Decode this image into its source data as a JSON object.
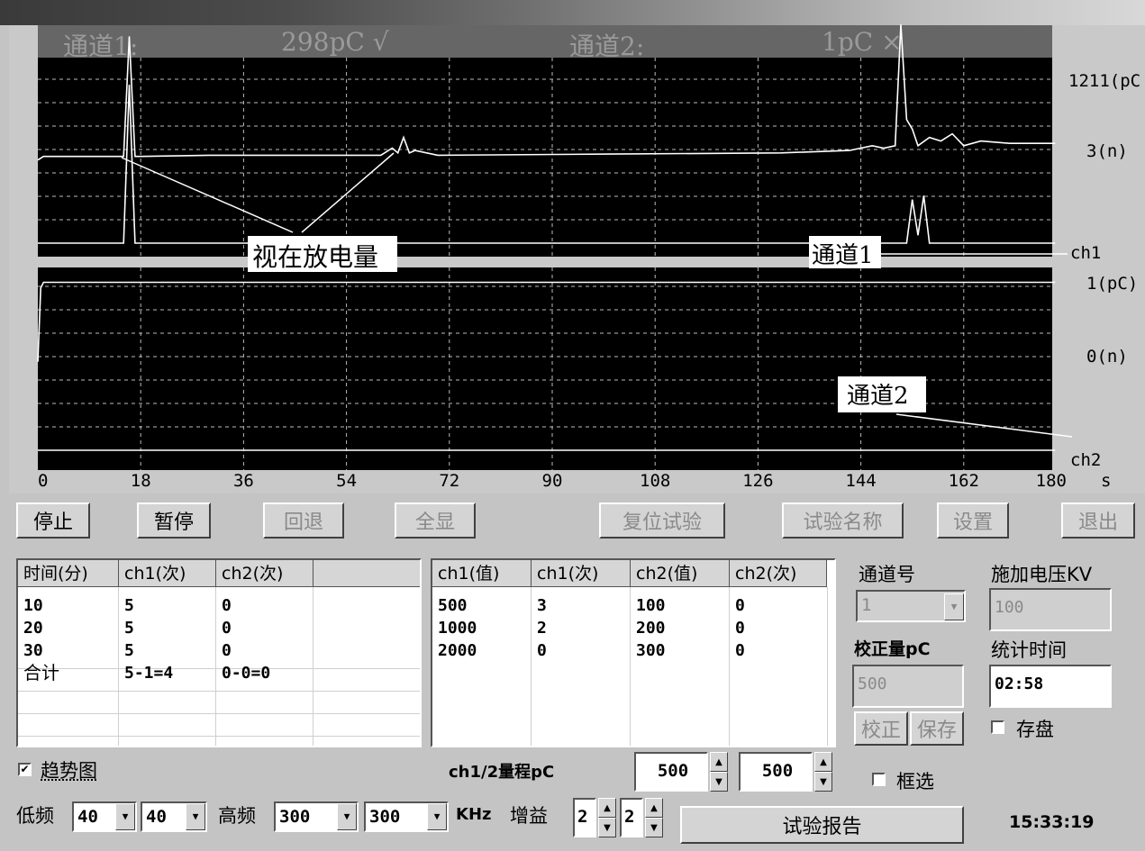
{
  "status": {
    "ch1_label": "通道1:",
    "ch1_value": "298pC √",
    "ch2_label": "通道2:",
    "ch2_value": "1pC ×"
  },
  "chart_data": {
    "type": "line",
    "x_ticks": [
      "0",
      "18",
      "36",
      "54",
      "72",
      "90",
      "108",
      "126",
      "144",
      "162",
      "180"
    ],
    "x_unit": "s",
    "xlim": [
      0,
      180
    ],
    "right_labels": {
      "ch1_top": "1211(pC",
      "ch1_mid": "3(n)",
      "ch1_name": "ch1",
      "ch2_top": "1(pC)",
      "ch2_mid": "0(n)",
      "ch2_name": "ch2"
    },
    "annotations": {
      "apparent_discharge": "视在放电量",
      "channel1": "通道1",
      "channel2": "通道2"
    },
    "series": [
      {
        "name": "ch1",
        "x": [
          0,
          1,
          15,
          16,
          17,
          18,
          30,
          40,
          60,
          62,
          63,
          64,
          65,
          66,
          70,
          100,
          130,
          142,
          146,
          148,
          150,
          151,
          152,
          153,
          154,
          156,
          158,
          160,
          162,
          165,
          170,
          178
        ],
        "y": [
          2.6,
          2.9,
          2.9,
          13.0,
          2.9,
          2.9,
          3.0,
          3.0,
          3.0,
          3.6,
          3.2,
          4.5,
          3.2,
          3.4,
          3.0,
          3.1,
          3.2,
          3.4,
          3.8,
          3.6,
          3.8,
          14.0,
          6.0,
          5.2,
          3.8,
          4.5,
          4.2,
          4.8,
          3.8,
          4.2,
          4.0,
          4.0
        ]
      },
      {
        "name": "ch1_pulse",
        "x": [
          0,
          14,
          15,
          16,
          17,
          18,
          150,
          152,
          153,
          154,
          155,
          156,
          178
        ],
        "y": [
          0,
          0,
          0,
          8.0,
          0,
          0,
          0,
          0,
          2.2,
          0.4,
          2.4,
          0,
          0
        ]
      },
      {
        "name": "ch2",
        "x": [
          0,
          0.5,
          1,
          178
        ],
        "y": [
          0.2,
          2.8,
          3.0,
          3.0
        ]
      },
      {
        "name": "ch2_base",
        "x": [
          0,
          178
        ],
        "y": [
          0,
          0
        ]
      }
    ]
  },
  "buttons": {
    "stop": "停止",
    "pause": "暂停",
    "back": "回退",
    "show_all": "全显",
    "reset_test": "复位试验",
    "test_name": "试验名称",
    "settings": "设置",
    "exit": "退出"
  },
  "table1": {
    "headers": [
      "时间(分)",
      "ch1(次)",
      "ch2(次)",
      ""
    ],
    "rows": [
      [
        "10",
        "5",
        "0"
      ],
      [
        "20",
        "5",
        "0"
      ],
      [
        "30",
        "5",
        "0"
      ],
      [
        "合计",
        "5-1=4",
        "0-0=0"
      ]
    ]
  },
  "table2": {
    "headers": [
      "ch1(值)",
      "ch1(次)",
      "ch2(值)",
      "ch2(次)"
    ],
    "rows": [
      [
        "500",
        "3",
        "100",
        "0"
      ],
      [
        "1000",
        "2",
        "200",
        "0"
      ],
      [
        "2000",
        "0",
        "300",
        "0"
      ]
    ]
  },
  "right_panel": {
    "channel_label": "通道号",
    "channel_value": "1",
    "voltage_label": "施加电压KV",
    "voltage_value": "100",
    "calib_label": "校正量pC",
    "calib_value": "500",
    "stat_time_label": "统计时间",
    "stat_time_value": "02:58",
    "calibrate_btn": "校正",
    "save_btn": "保存",
    "save_disk": "存盘",
    "frame_select": "框选"
  },
  "bottom": {
    "trend_label": "趋势图",
    "range_label": "ch1/2量程pC",
    "range1": "500",
    "range2": "500",
    "low_label": "低频",
    "low1": "40",
    "low2": "40",
    "high_label": "高频",
    "high1": "300",
    "high2": "300",
    "khz": "KHz",
    "gain_label": "增益",
    "gain1": "2",
    "gain2": "2",
    "report_btn": "试验报告",
    "clock": "15:33:19"
  }
}
